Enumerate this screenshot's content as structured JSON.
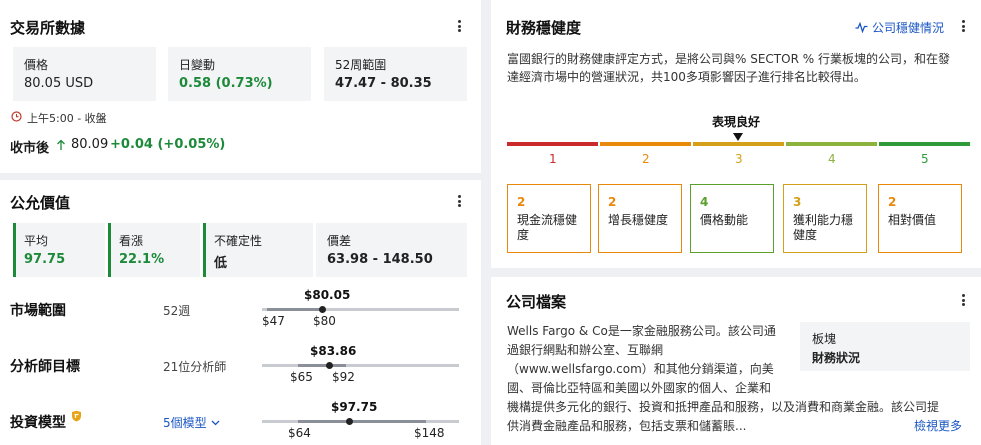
{
  "exchange": {
    "title": "交易所數據",
    "price": {
      "label": "價格",
      "value": "80.05 USD"
    },
    "day_change": {
      "label": "日變動",
      "value": "0.58 (0.73%)"
    },
    "range52": {
      "label": "52周範圍",
      "value": "47.47 - 80.35"
    },
    "status": "上午5:00 - 收盤",
    "after_hours": {
      "label": "收市後",
      "price": "80.09",
      "change": "+0.04 (+0.05%)"
    }
  },
  "fair_value": {
    "title": "公允價值",
    "average": {
      "label": "平均",
      "value": "97.75"
    },
    "upside": {
      "label": "看漲",
      "value": "22.1%"
    },
    "uncertainty": {
      "label": "不確定性",
      "value": "低"
    },
    "spread": {
      "label": "價差",
      "value": "63.98 - 148.50"
    },
    "rows": [
      {
        "label": "市場範圍",
        "sub": "52週",
        "top": "$80.05",
        "low": "$47",
        "high": "$80",
        "position": 1.0
      },
      {
        "label": "分析師目標",
        "sub": "21位分析師",
        "top": "$83.86",
        "low": "$65",
        "high": "$92",
        "position": 0.7
      },
      {
        "label": "投資模型",
        "sub": "5個模型",
        "top": "$97.75",
        "low": "$64",
        "high": "$148",
        "position": 0.4
      }
    ]
  },
  "health": {
    "title": "財務穩健度",
    "link": "公司穩健情況",
    "description_lines": [
      "富國銀行的財務健康評定方式，是將公司與% SECTOR % 行業板塊的公司，和在發",
      "達經濟市場中的營運狀況，共100多項影響因子進行排名比較得出。"
    ],
    "rating_label": "表現良好",
    "rating_value": 3,
    "scale": [
      {
        "num": "1",
        "color": "#c92a2a"
      },
      {
        "num": "2",
        "color": "#e8890c"
      },
      {
        "num": "3",
        "color": "#d4a017"
      },
      {
        "num": "4",
        "color": "#8cb33c"
      },
      {
        "num": "5",
        "color": "#2f9a3a"
      }
    ],
    "factors": [
      {
        "score": "2",
        "label": "現金流穩健度",
        "color": "#e8890c"
      },
      {
        "score": "2",
        "label": "增長穩健度",
        "color": "#e8890c"
      },
      {
        "score": "4",
        "label": "價格動能",
        "color": "#5aa02c"
      },
      {
        "score": "3",
        "label": "獲利能力穩健度",
        "color": "#d4a017"
      },
      {
        "score": "2",
        "label": "相對價值",
        "color": "#e8890c"
      }
    ]
  },
  "profile": {
    "title": "公司檔案",
    "lines": [
      "Wells Fargo & Co是一家金融服務公司。該公司通",
      "過銀行網點和辦公室、互聯網",
      "（www.wellsfargo.com）和其他分銷渠道，向美",
      "國、哥倫比亞特區和美國以外國家的個人、企業和",
      "機構提供多元化的銀行、投資和抵押產品和服務，以及消費和商業金融。該公司提",
      "供消費金融產品和服務，包括支票和儲蓄賬..."
    ],
    "sector_label": "板塊",
    "sector_value": "財務狀況",
    "more": "檢視更多"
  }
}
